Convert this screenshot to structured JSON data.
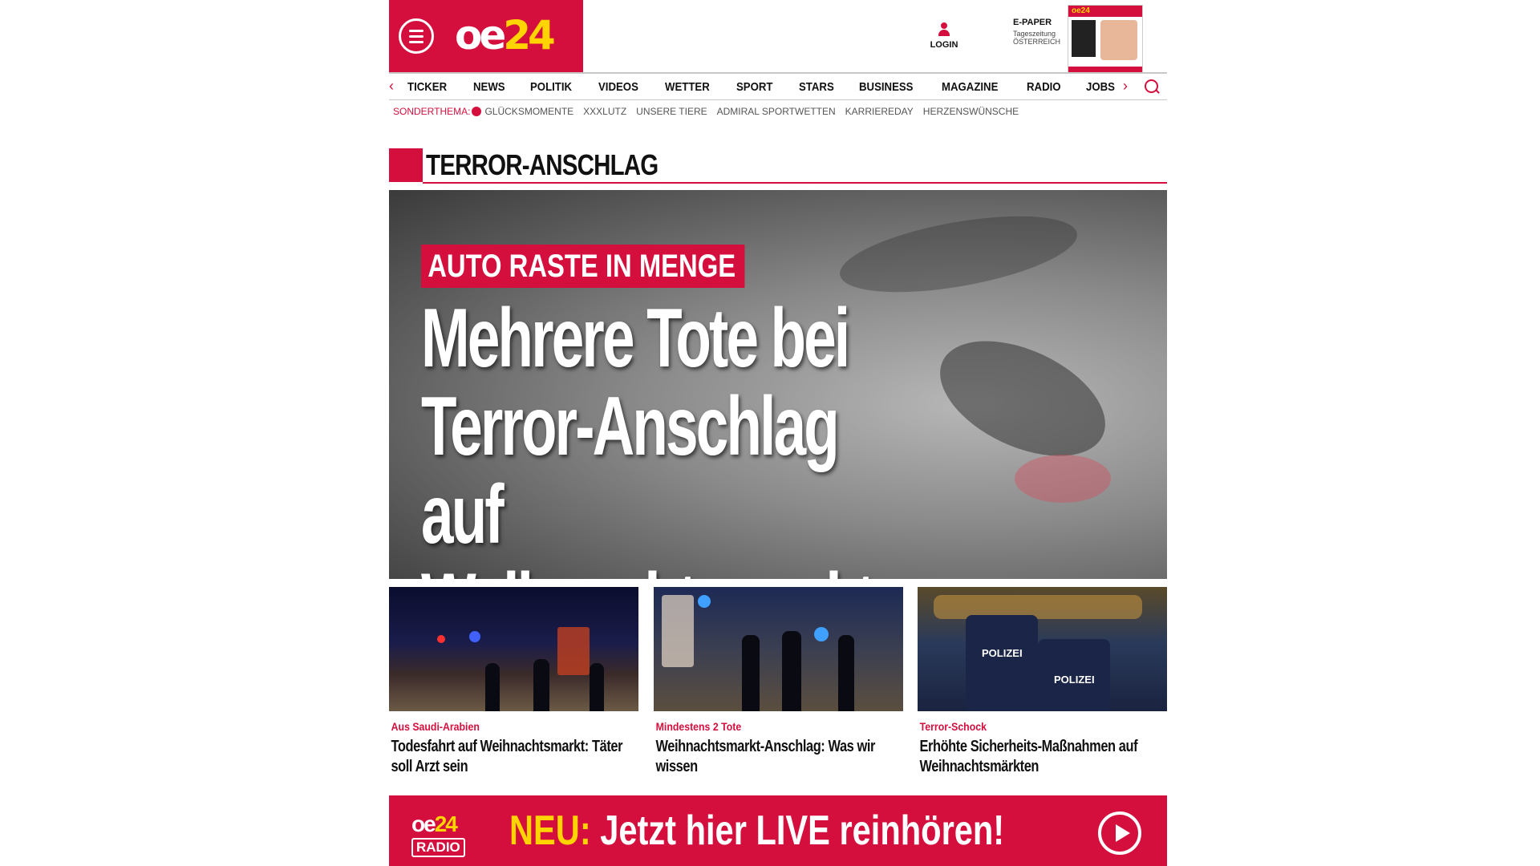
{
  "header": {
    "logo_main": "oe",
    "logo_num": "24",
    "login_label": "LOGIN",
    "epaper": {
      "title": "E-PAPER",
      "line1": "Tageszeitung",
      "line2": "ÖSTERREICH"
    },
    "cover_title": "oe24"
  },
  "nav": {
    "prev_arrow": "‹",
    "next_arrow": "›",
    "items": [
      "TICKER",
      "NEWS",
      "POLITIK",
      "VIDEOS",
      "WETTER",
      "SPORT",
      "STARS",
      "BUSINESS",
      "MAGAZINE",
      "RADIO",
      "JOBS"
    ]
  },
  "subnav": {
    "label": "SONDERTHEMA:",
    "items": [
      "GLÜCKSMOMENTE",
      "XXXLUTZ",
      "UNSERE TIERE",
      "ADMIRAL SPORTWETTEN",
      "KARRIEREDAY",
      "HERZENSWÜNSCHE"
    ]
  },
  "section": {
    "title": "TERROR-ANSCHLAG"
  },
  "hero": {
    "kicker": "AUTO RASTE IN MENGE",
    "headline": "Mehrere Tote bei Terror-Anschlag auf Weihnachtsmarkt"
  },
  "teasers": [
    {
      "kicker": "Aus Saudi-Arabien",
      "title": "Todesfahrt auf Weihnachtsmarkt: Täter soll Arzt sein"
    },
    {
      "kicker": "Mindestens 2 Tote",
      "title": "Weihnachtsmarkt-Anschlag: Was wir wissen"
    },
    {
      "kicker": "Terror-Schock",
      "title": "Erhöhte Sicherheits-Maßnahmen auf Weihnachtsmärkten",
      "badge1": "POLIZEI",
      "badge2": "POLIZEI"
    }
  ],
  "radio_banner": {
    "logo_main": "oe",
    "logo_num": "24",
    "logo_sub": "RADIO",
    "neu": "NEU:",
    "text": "Jetzt hier LIVE reinhören!"
  },
  "colors": {
    "brand_red": "#d50f3d",
    "accent_yellow": "#ffd400"
  }
}
